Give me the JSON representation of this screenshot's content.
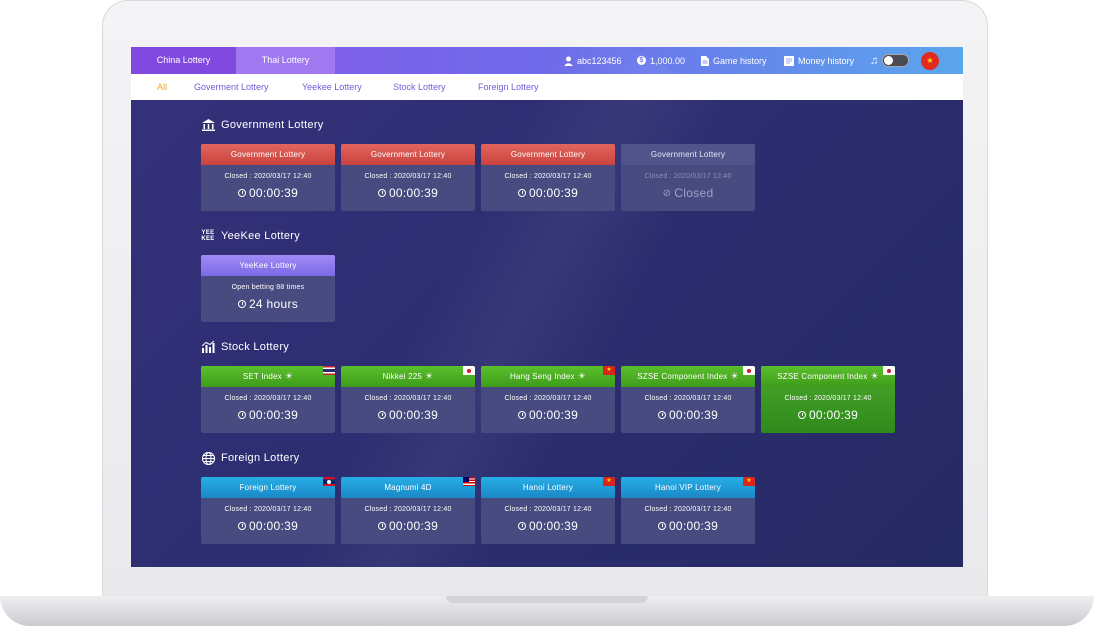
{
  "tabs": [
    {
      "label": "China Lottery"
    },
    {
      "label": "Thai Lottery"
    }
  ],
  "user": {
    "username": "abc123456",
    "balance": "1,000.00",
    "game_history": "Game history",
    "money_history": "Money history"
  },
  "subnav": [
    "All",
    "Goverment Lottery",
    "Yeekee Lottery",
    "Stock Lottery",
    "Foreign Lottery"
  ],
  "sections": {
    "government": {
      "title": "Government Lottery",
      "cards": [
        {
          "name": "Government Lottery",
          "info": "Closed : 2020/03/17 12:40",
          "time": "00:00:39"
        },
        {
          "name": "Government Lottery",
          "info": "Closed : 2020/03/17 12:40",
          "time": "00:00:39"
        },
        {
          "name": "Government Lottery",
          "info": "Closed : 2020/03/17 12:40",
          "time": "00:00:39"
        },
        {
          "name": "Government Lottery",
          "info": "Closed : 2020/03/17 12:40",
          "time": "Closed"
        }
      ]
    },
    "yeekee": {
      "title": "YeeKee Lottery",
      "cards": [
        {
          "name": "YeeKee Lottery",
          "info": "Open betting 88 times",
          "time": "24 hours"
        }
      ]
    },
    "stock": {
      "title": "Stock Lottery",
      "cards": [
        {
          "name": "SET Index",
          "info": "Closed : 2020/03/17 12:40",
          "time": "00:00:39"
        },
        {
          "name": "Nikkei 225",
          "info": "Closed : 2020/03/17 12:40",
          "time": "00:00:39"
        },
        {
          "name": "Hang Seng Index",
          "info": "Closed : 2020/03/17 12:40",
          "time": "00:00:39"
        },
        {
          "name": "SZSE Component Index",
          "info": "Closed : 2020/03/17 12:40",
          "time": "00:00:39"
        },
        {
          "name": "SZSE Component Index",
          "info": "Closed : 2020/03/17 12:40",
          "time": "00:00:39"
        }
      ]
    },
    "foreign": {
      "title": "Foreign Lottery",
      "cards": [
        {
          "name": "Foreign Lottery",
          "info": "Closed : 2020/03/17 12:40",
          "time": "00:00:39"
        },
        {
          "name": "Magnumi 4D",
          "info": "Closed : 2020/03/17 12:40",
          "time": "00:00:39"
        },
        {
          "name": "Hanoi Lottery",
          "info": "Closed : 2020/03/17 12:40",
          "time": "00:00:39"
        },
        {
          "name": "Hanoi VIP Lottery",
          "info": "Closed : 2020/03/17 12:40",
          "time": "00:00:39"
        }
      ]
    }
  },
  "colors": {
    "header_gradient_start": "#8a56e6",
    "header_gradient_end": "#5aa6ec",
    "background": "#2c2d69",
    "red": "#d4504b",
    "green": "#4cae24",
    "blue": "#1f9cd8",
    "purple": "#8d7af0",
    "active_link": "#f5a623"
  }
}
